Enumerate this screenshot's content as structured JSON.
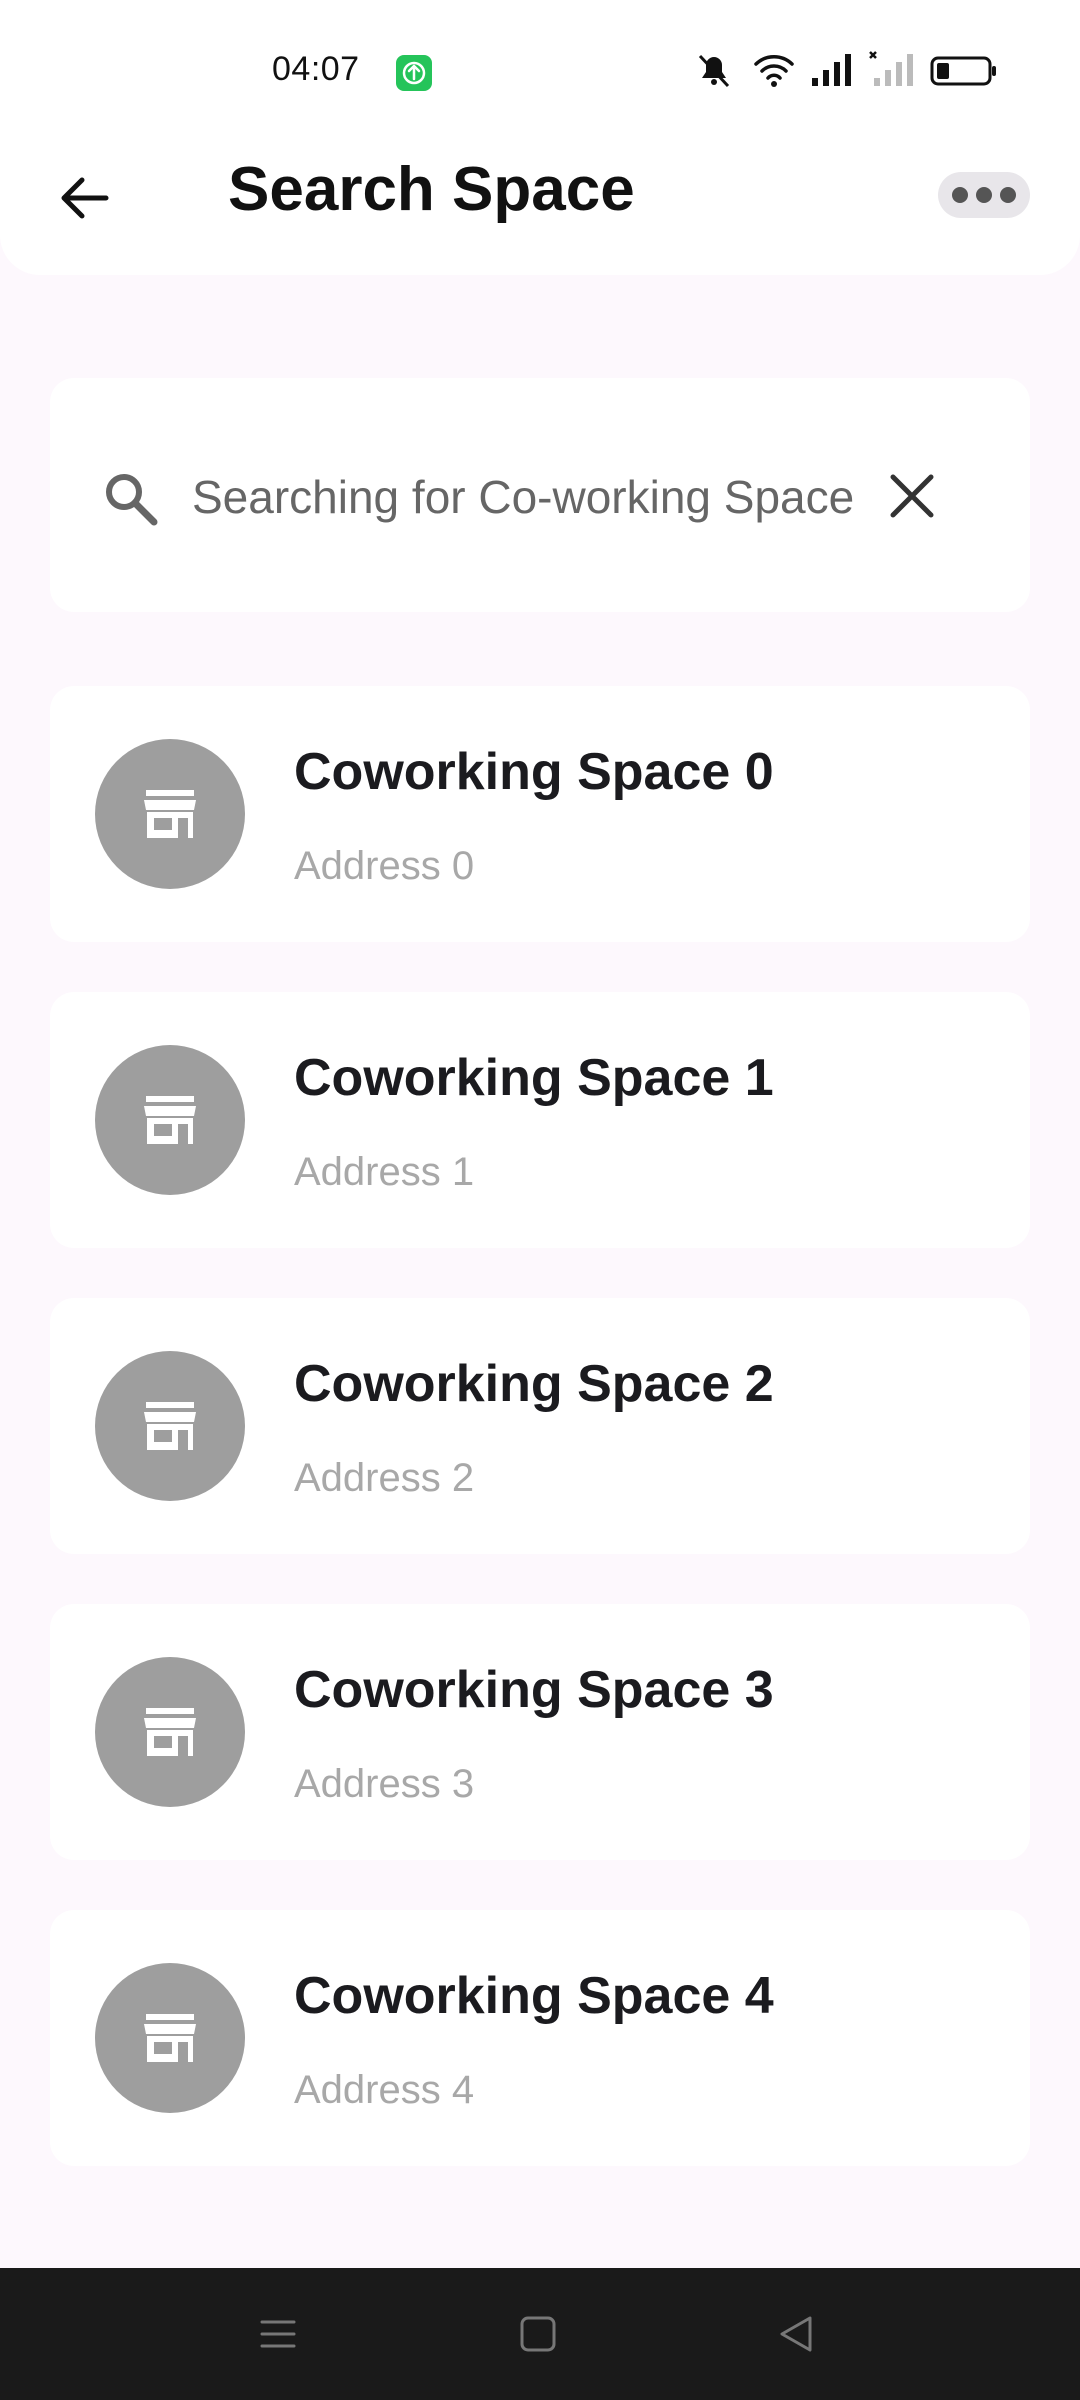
{
  "status_bar": {
    "time": "04:07",
    "icons": [
      "app-notification-icon",
      "mute-icon",
      "wifi-icon",
      "signal-icon",
      "signal-no-sim-icon",
      "battery-icon"
    ]
  },
  "header": {
    "title": "Search Space",
    "back_icon": "arrow-left-icon",
    "more_icon": "more-horizontal-icon"
  },
  "search": {
    "value": "Searching for Co-working Space",
    "icon": "search-icon",
    "clear_icon": "close-icon"
  },
  "spaces": [
    {
      "name": "Coworking Space 0",
      "address": "Address 0",
      "icon": "store-icon"
    },
    {
      "name": "Coworking Space 1",
      "address": "Address 1",
      "icon": "store-icon"
    },
    {
      "name": "Coworking Space 2",
      "address": "Address 2",
      "icon": "store-icon"
    },
    {
      "name": "Coworking Space 3",
      "address": "Address 3",
      "icon": "store-icon"
    },
    {
      "name": "Coworking Space 4",
      "address": "Address 4",
      "icon": "store-icon"
    }
  ],
  "nav_bar": {
    "buttons": [
      "menu-icon",
      "home-icon",
      "back-triangle-icon"
    ]
  },
  "colors": {
    "background": "#fdf8fd",
    "card": "#ffffff",
    "avatar": "#9e9e9e",
    "title_text": "#1b1b1f",
    "subtitle_text": "#a8a8a8",
    "nav_bar": "#1a1a1a"
  }
}
